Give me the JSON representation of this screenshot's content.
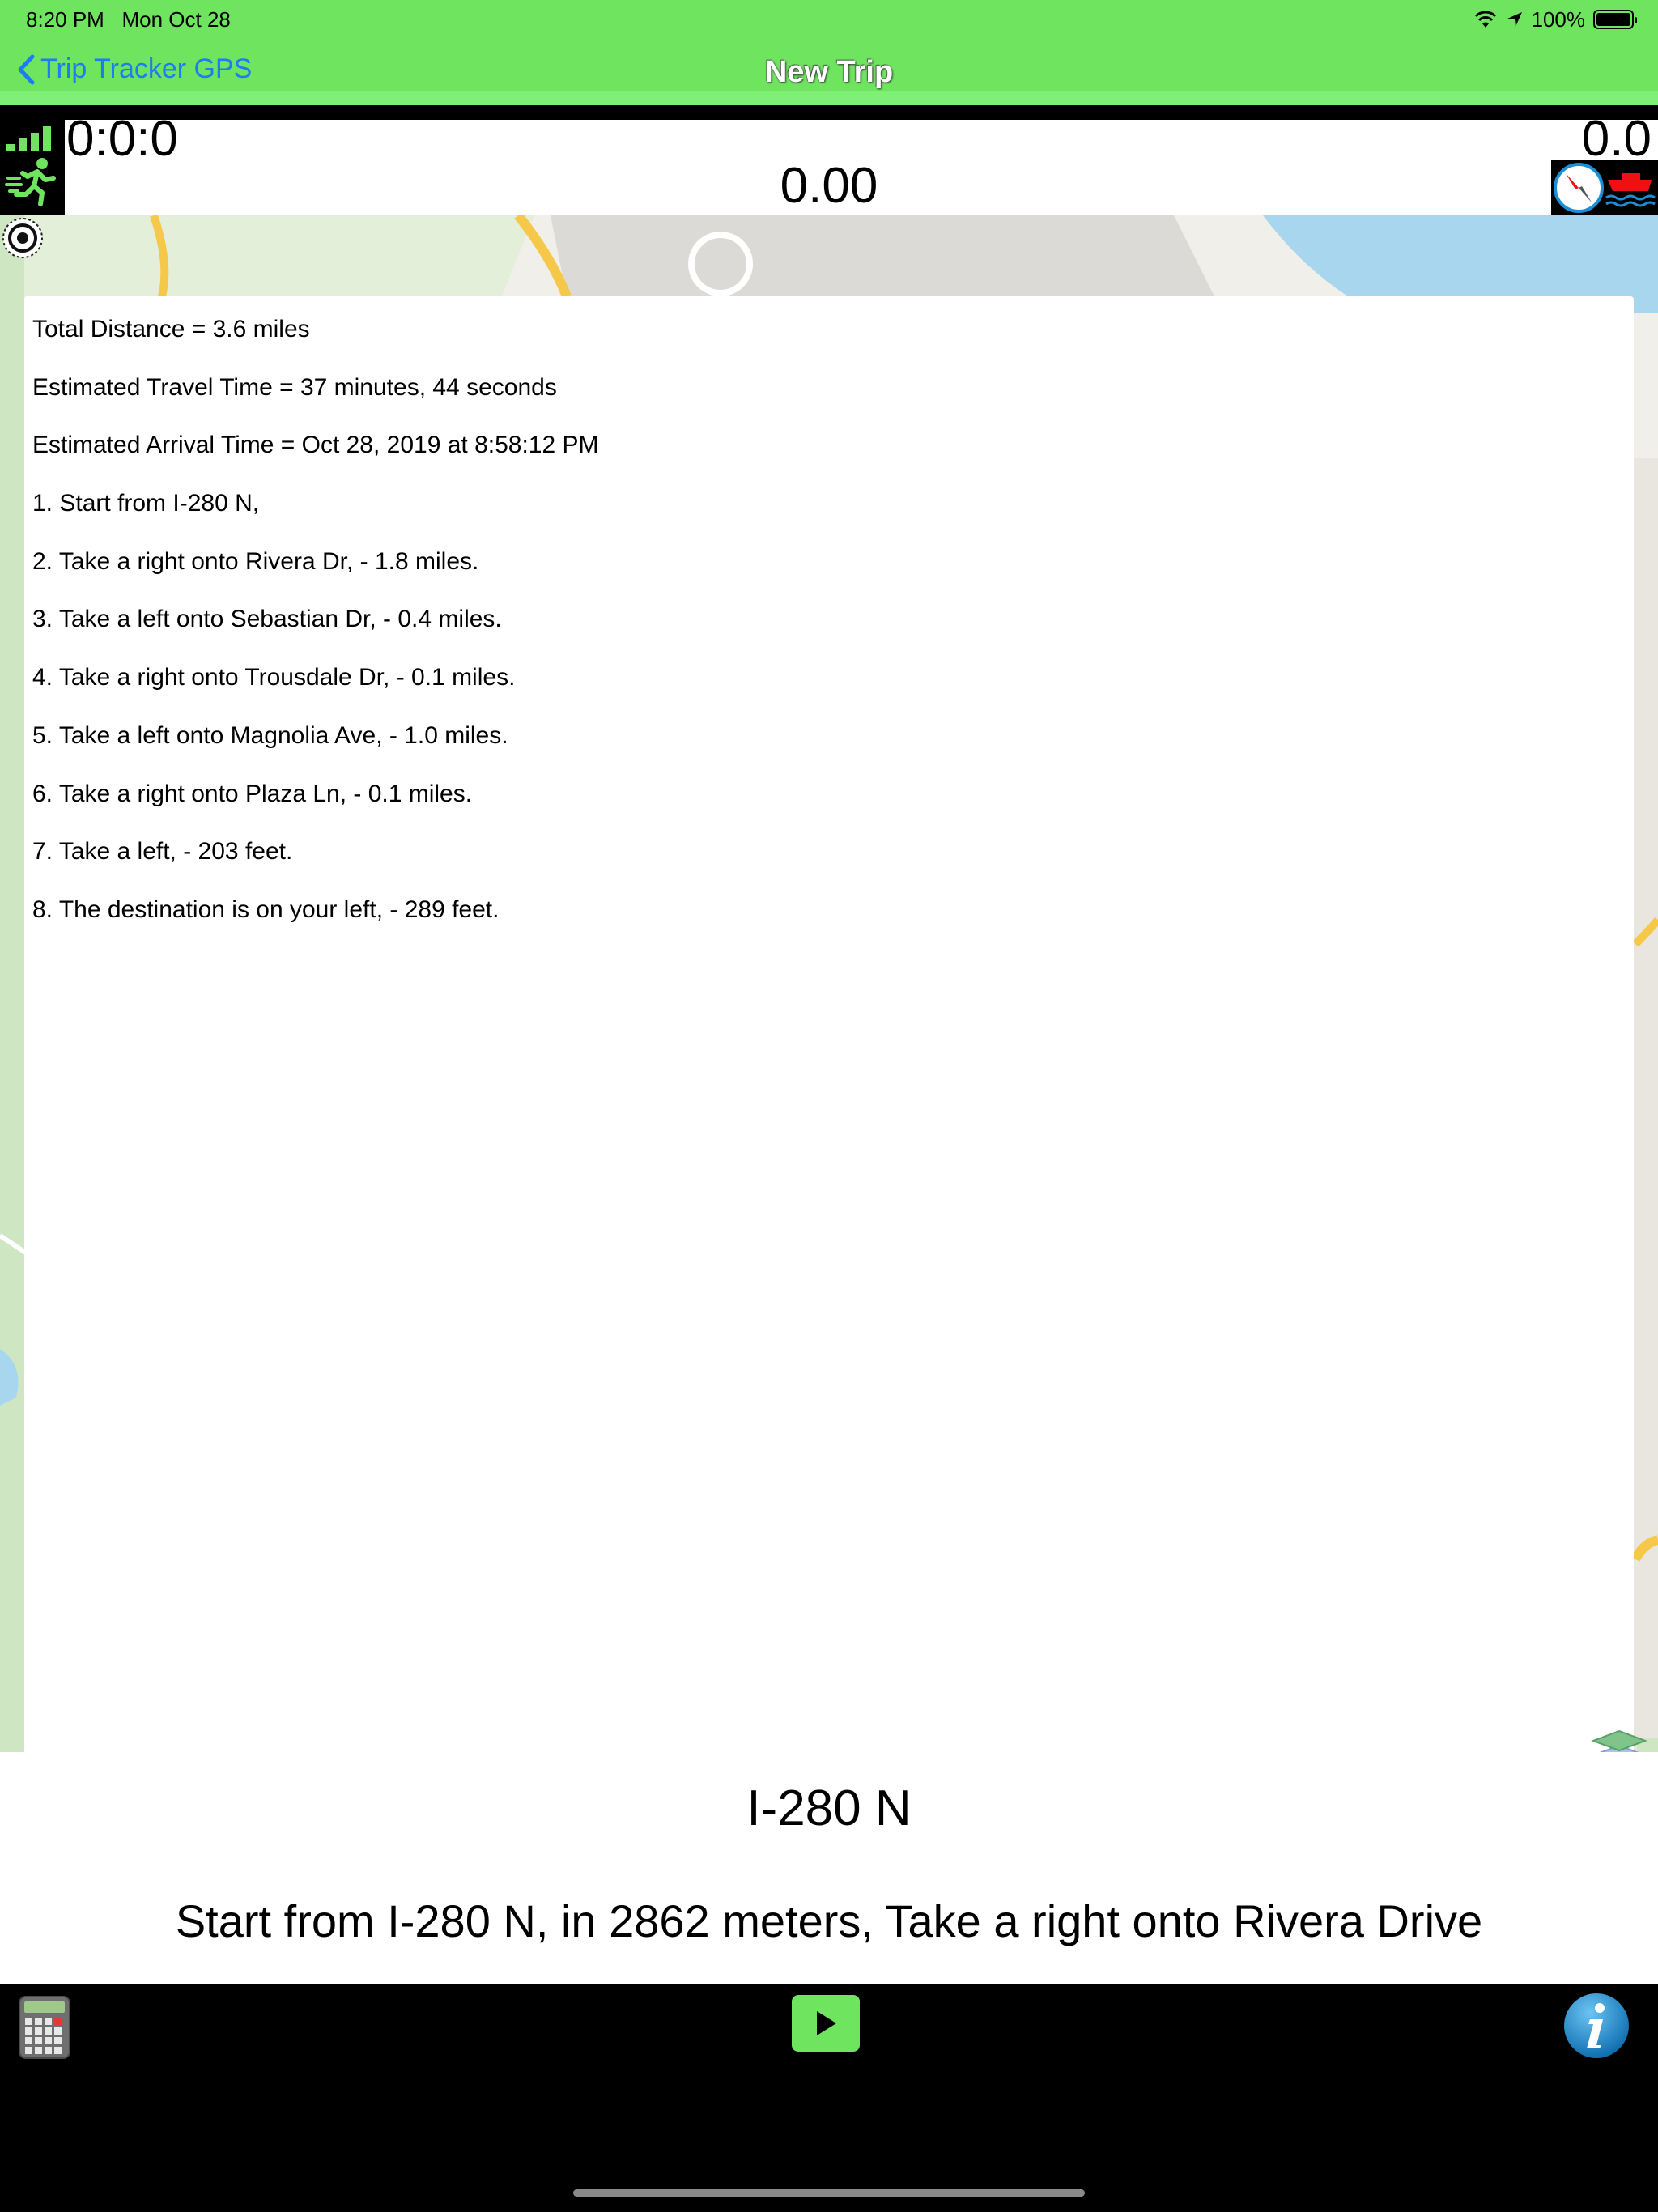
{
  "status_bar": {
    "time": "8:20 PM",
    "date": "Mon Oct 28",
    "battery": "100%"
  },
  "navbar": {
    "back_label": "Trip Tracker GPS",
    "title": "New Trip"
  },
  "stats": {
    "elapsed": "0:0:0",
    "distance": "0.00",
    "speed": "0.0"
  },
  "directions": {
    "lines": [
      "Total Distance =  3.6 miles",
      "Estimated Travel Time =  37 minutes, 44 seconds",
      "Estimated Arrival Time =  Oct 28, 2019 at 8:58:12 PM",
      "1. Start from I-280 N,",
      "2. Take a right onto Rivera Dr, -  1.8 miles.",
      "3. Take a left onto Sebastian Dr, -  0.4 miles.",
      "4. Take a right onto Trousdale Dr, -  0.1 miles.",
      "5. Take a left onto Magnolia Ave, -  1.0 miles.",
      "6. Take a right onto Plaza Ln, -  0.1 miles.",
      "7. Take a left, -  203 feet.",
      "8. The destination is on your left, -  289 feet."
    ]
  },
  "instruction": {
    "road": "I-280 N",
    "text": "Start from I-280 N, in 2862 meters, Take a right onto Rivera Drive"
  },
  "icons": {
    "signal": "signal-bars-icon",
    "runner": "runner-icon",
    "compass": "compass-icon",
    "boat": "boat-icon",
    "target": "location-target-icon",
    "layers": "map-layers-icon",
    "calculator": "calculator-icon",
    "play": "play-icon",
    "info": "info-icon"
  },
  "colors": {
    "accent_green": "#6ee45f",
    "link_blue": "#1d7cf2",
    "info_blue": "#1a8fd6"
  }
}
